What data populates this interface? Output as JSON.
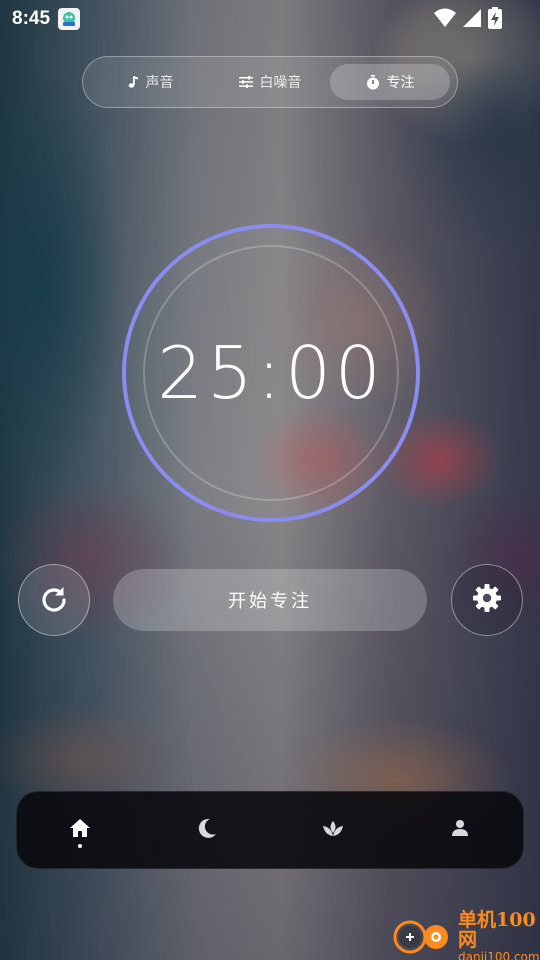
{
  "status_bar": {
    "time": "8:45",
    "icons": [
      "app-notification-icon",
      "wifi-icon",
      "cell-signal-icon",
      "battery-charging-icon"
    ]
  },
  "tabs": [
    {
      "label": "声音",
      "icon": "music-note-icon",
      "active": false
    },
    {
      "label": "白噪音",
      "icon": "tune-sliders-icon",
      "active": false
    },
    {
      "label": "专注",
      "icon": "timer-icon",
      "active": true
    }
  ],
  "timer": {
    "display": "25:00",
    "ring_color": "#8a8cf0"
  },
  "controls": {
    "reset_icon": "refresh-icon",
    "start_label": "开始专注",
    "settings_icon": "gear-icon"
  },
  "bottom_nav": [
    {
      "icon": "home-icon",
      "active": true
    },
    {
      "icon": "moon-icon",
      "active": false
    },
    {
      "icon": "lotus-icon",
      "active": false
    },
    {
      "icon": "person-icon",
      "active": false
    }
  ],
  "watermark": {
    "title": "单机100网",
    "url": "danji100.com",
    "color": "#ff8a1d"
  }
}
